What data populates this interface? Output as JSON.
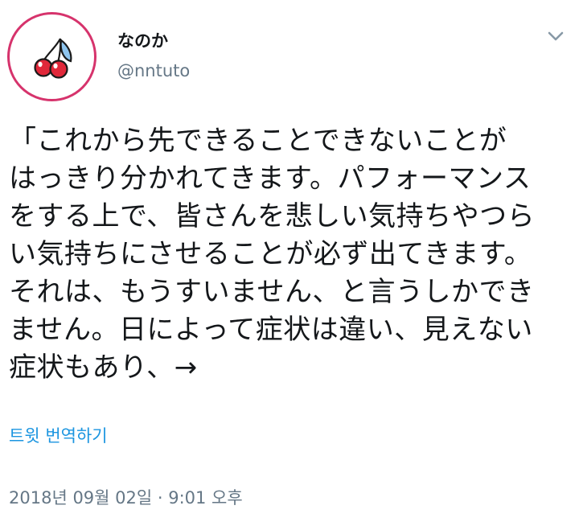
{
  "user": {
    "display_name": "なのか",
    "handle": "@nntuto",
    "avatar_icon": "cherry-icon"
  },
  "tweet": {
    "lines": [
      "「これから先できることできないことが",
      "はっきり分かれてきます。パフォーマンス",
      "をする上で、皆さんを悲しい気持ちやつら",
      "い気持ちにさせることが必ず出てきます。",
      "それは、もうすいません、と言うしかでき",
      "ません。日によって症状は違い、見えない",
      "症状もあり、→"
    ],
    "translate_label": "트윗 번역하기",
    "timestamp": "2018년 09월 02일 · 9:01 오후"
  },
  "menu": {
    "icon": "chevron-down-icon"
  },
  "colors": {
    "avatar_border": "#d6336c",
    "cherry_red": "#e0283a",
    "leaf_blue": "#8ec5ee",
    "link_blue": "#1b95e0",
    "secondary_gray": "#657786",
    "text_dark": "#14171a"
  }
}
